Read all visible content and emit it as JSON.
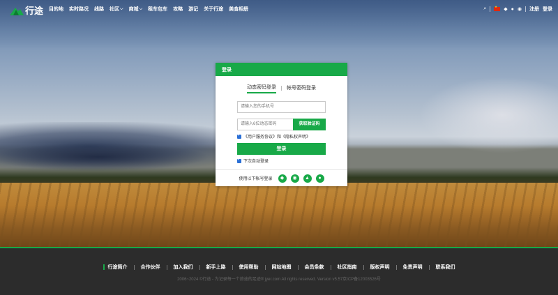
{
  "brand": {
    "logo_text": "行途",
    "accent": "#18a948"
  },
  "nav": {
    "items": [
      {
        "label": "目的地",
        "has_dropdown": false
      },
      {
        "label": "实时路况",
        "has_dropdown": false
      },
      {
        "label": "线路",
        "has_dropdown": false
      },
      {
        "label": "社区",
        "has_dropdown": true
      },
      {
        "label": "商城",
        "has_dropdown": true
      },
      {
        "label": "租车包车",
        "has_dropdown": false
      },
      {
        "label": "攻略",
        "has_dropdown": false
      },
      {
        "label": "游记",
        "has_dropdown": false
      },
      {
        "label": "关于行途",
        "has_dropdown": false
      },
      {
        "label": "美食相册",
        "has_dropdown": false
      }
    ],
    "chevron": "⌵"
  },
  "top_right": {
    "search_icon": "⌕",
    "qq_icon": "◆",
    "wechat_icon": "●",
    "weibo_icon": "◉",
    "register": "注册",
    "login": "登录"
  },
  "login_card": {
    "header": "登录",
    "tab_dynamic": "动态密码登录",
    "tab_account": "帐号密码登录",
    "phone_placeholder": "请输入您的手机号",
    "code_placeholder": "请输入6位动态密码",
    "get_code_button": "获取验证码",
    "agreement": "《用户服务协议》和《隐私权声明》",
    "login_button": "登录",
    "auto_login": "下次自动登录",
    "social_label": "使用以下帐号登录",
    "social_icons": {
      "qq": "◆",
      "weibo": "◉",
      "qq2": "▲",
      "wechat": "●"
    }
  },
  "footer": {
    "links": [
      "行途简介",
      "合作伙伴",
      "加入我们",
      "新手上路",
      "使用帮助",
      "网站地图",
      "会员条款",
      "社区指南",
      "版权声明",
      "免责声明",
      "联系我们"
    ],
    "copyright": "2006~2024 ©行途 - 为记录每一个旅途的足迹® jyer.com All rights reserved. Version v5.57京ICP备12003526号"
  }
}
